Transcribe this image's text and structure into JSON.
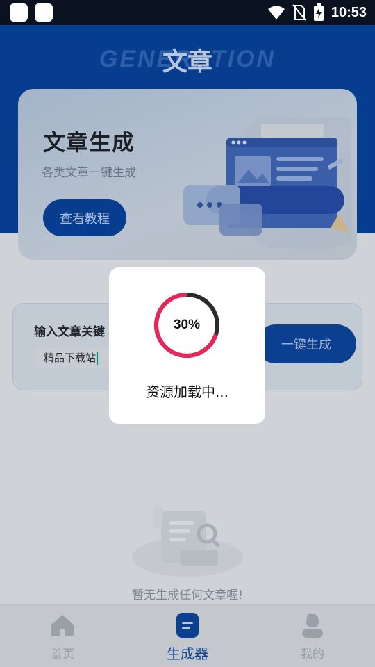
{
  "status_bar": {
    "time": "10:53",
    "icons": [
      "app-square-icon",
      "app-square-icon",
      "wifi-icon",
      "no-sim-icon",
      "battery-charging-icon"
    ]
  },
  "header": {
    "watermark": "GENERATION",
    "title": "文章"
  },
  "banner": {
    "title": "文章生成",
    "subtitle": "各类文章一键生成",
    "tutorial_button": "查看教程"
  },
  "generator": {
    "label": "输入文章关键",
    "input_value": "精品下载站",
    "generate_button": "一键生成"
  },
  "empty_state": {
    "message": "暂无生成任何文章喔!"
  },
  "bottom_nav": {
    "items": [
      {
        "label": "首页",
        "icon": "home-icon",
        "active": false
      },
      {
        "label": "生成器",
        "icon": "document-icon",
        "active": true
      },
      {
        "label": "我的",
        "icon": "user-icon",
        "active": false
      }
    ]
  },
  "loading_dialog": {
    "progress_text": "30%",
    "progress": 0.3,
    "message": "资源加载中..."
  },
  "colors": {
    "primary": "#0b3f8f",
    "progress_arc": "#e8265a",
    "progress_track": "#2b2b2b"
  }
}
